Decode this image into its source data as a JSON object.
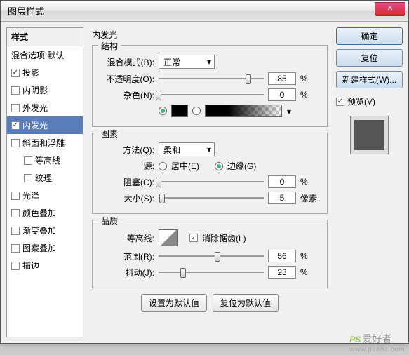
{
  "window": {
    "title": "图层样式"
  },
  "left": {
    "header": "样式",
    "blending": "混合选项:默认",
    "items": [
      {
        "label": "投影",
        "checked": true
      },
      {
        "label": "内阴影",
        "checked": false
      },
      {
        "label": "外发光",
        "checked": false
      },
      {
        "label": "内发光",
        "checked": true,
        "active": true
      },
      {
        "label": "斜面和浮雕",
        "checked": false
      },
      {
        "label": "等高线",
        "checked": false,
        "sub": true
      },
      {
        "label": "纹理",
        "checked": false,
        "sub": true
      },
      {
        "label": "光泽",
        "checked": false
      },
      {
        "label": "颜色叠加",
        "checked": false
      },
      {
        "label": "渐变叠加",
        "checked": false
      },
      {
        "label": "图案叠加",
        "checked": false
      },
      {
        "label": "描边",
        "checked": false
      }
    ]
  },
  "mid": {
    "title": "内发光",
    "structure": {
      "legend": "结构",
      "blendMode": {
        "label": "混合模式(B):",
        "value": "正常"
      },
      "opacity": {
        "label": "不透明度(O):",
        "value": "85",
        "unit": "%",
        "pos": 85
      },
      "noise": {
        "label": "杂色(N):",
        "value": "0",
        "unit": "%",
        "pos": 0
      }
    },
    "elements": {
      "legend": "图素",
      "technique": {
        "label": "方法(Q):",
        "value": "柔和"
      },
      "source": {
        "label": "源:",
        "center": "居中(E)",
        "edge": "边缘(G)"
      },
      "choke": {
        "label": "阻塞(C):",
        "value": "0",
        "unit": "%",
        "pos": 0
      },
      "size": {
        "label": "大小(S):",
        "value": "5",
        "unit": "像素",
        "pos": 3
      }
    },
    "quality": {
      "legend": "品质",
      "contour": {
        "label": "等高线:",
        "antialias": "消除锯齿(L)"
      },
      "range": {
        "label": "范围(R):",
        "value": "56",
        "unit": "%",
        "pos": 56
      },
      "jitter": {
        "label": "抖动(J):",
        "value": "23",
        "unit": "%",
        "pos": 23
      }
    },
    "buttons": {
      "default": "设置为默认值",
      "reset": "复位为默认值"
    }
  },
  "right": {
    "ok": "确定",
    "cancel": "复位",
    "newStyle": "新建样式(W)...",
    "preview": "预览(V)"
  },
  "watermark": {
    "brand": "PS",
    "cn": "爱好者",
    "url": "www.psahz.com"
  }
}
